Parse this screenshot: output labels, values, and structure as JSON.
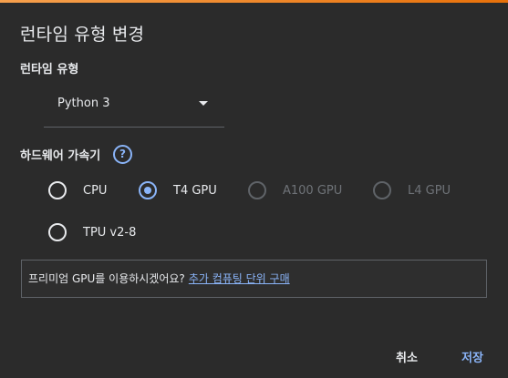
{
  "dialog": {
    "title": "런타임 유형 변경",
    "accent_color": "#f39c4a"
  },
  "runtime": {
    "label": "런타임 유형",
    "selected": "Python 3"
  },
  "hardware": {
    "label": "하드웨어 가속기",
    "help_icon": "?",
    "options": [
      {
        "label": "CPU",
        "checked": false,
        "disabled": false
      },
      {
        "label": "T4 GPU",
        "checked": true,
        "disabled": false
      },
      {
        "label": "A100 GPU",
        "checked": false,
        "disabled": true
      },
      {
        "label": "L4 GPU",
        "checked": false,
        "disabled": true
      },
      {
        "label": "TPU v2-8",
        "checked": false,
        "disabled": false
      }
    ]
  },
  "promo": {
    "text": "프리미엄 GPU를 이용하시겠어요?",
    "link": "추가 컴퓨팅 단위 구매"
  },
  "actions": {
    "cancel": "취소",
    "save": "저장"
  },
  "colors": {
    "background": "#2b2b2b",
    "accent_blue": "#8ab4f8",
    "text": "#e8eaed",
    "disabled": "#6f7378"
  }
}
